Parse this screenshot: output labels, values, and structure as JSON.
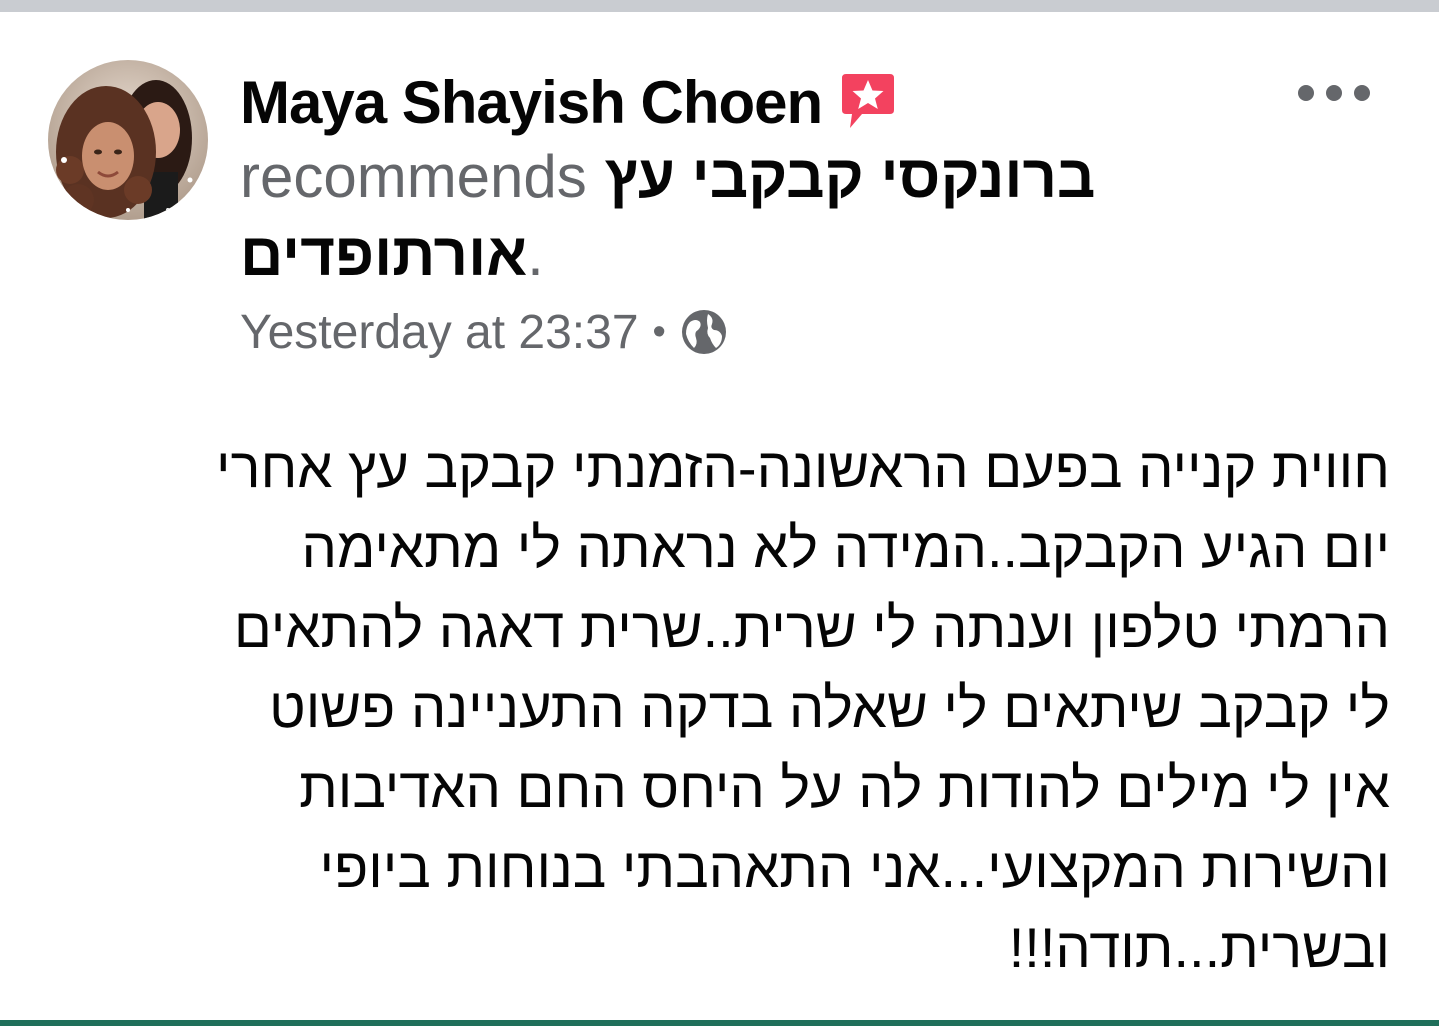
{
  "post": {
    "author": "Maya Shayish Choen",
    "recommends_word": "recommends",
    "page_name_part1": "ברונקסי קבקבי עץ",
    "page_name_part2": "אורתופדים",
    "period": ".",
    "timestamp": "Yesterday at 23:37",
    "separator": "•",
    "privacy_icon": "globe-icon",
    "recommend_icon": "recommendation-star-icon",
    "more_icon": "more-options-icon",
    "body_lines": [
      "חווית קנייה בפעם הראשונה-הזמנתי קבקב עץ אחרי",
      "יום הגיע הקבקב..המידה לא נראתה לי מתאימה",
      "הרמתי טלפון וענתה לי שרית..שרית דאגה להתאים",
      "לי קבקב שיתאים לי שאלה בדקה התעניינה פשוט",
      "אין לי מילים להודות לה על היחס החם האדיבות",
      "והשירות המקצועי...אני התאהבתי בנוחות ביופי",
      "ובשרית...תודה!!!"
    ]
  },
  "colors": {
    "primary_text": "#050505",
    "secondary_text": "#65676b",
    "recommend_badge": "#f3425f",
    "top_strip": "#c9ccd1",
    "bottom_strip": "#1f6f5a"
  }
}
